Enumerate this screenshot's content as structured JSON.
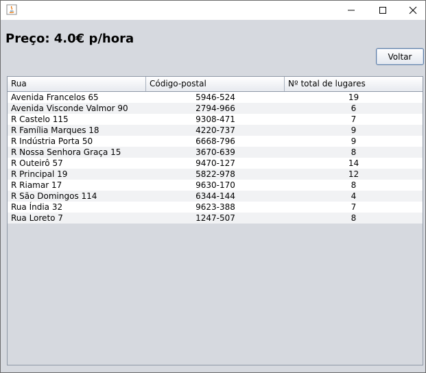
{
  "window": {
    "title": "",
    "icons": {
      "app": "java-app-icon",
      "minimize": "minimize-icon",
      "maximize": "maximize-icon",
      "close": "close-icon"
    }
  },
  "price": {
    "label": "Preço: 4.0€ p/hora"
  },
  "actions": {
    "back_label": "Voltar"
  },
  "table": {
    "columns": [
      "Rua",
      "Código-postal",
      "Nº total de lugares"
    ],
    "rows": [
      {
        "street": "Avenida Francelos 65",
        "postal_code": "5946-524",
        "total_spaces": "19"
      },
      {
        "street": "Avenida Visconde Valmor 90",
        "postal_code": "2794-966",
        "total_spaces": "6"
      },
      {
        "street": "R Castelo 115",
        "postal_code": "9308-471",
        "total_spaces": "7"
      },
      {
        "street": "R Família Marques 18",
        "postal_code": "4220-737",
        "total_spaces": "9"
      },
      {
        "street": "R Indústria Porta 50",
        "postal_code": "6668-796",
        "total_spaces": "9"
      },
      {
        "street": "R Nossa Senhora Graça 15",
        "postal_code": "3670-639",
        "total_spaces": "8"
      },
      {
        "street": "R Outeirô 57",
        "postal_code": "9470-127",
        "total_spaces": "14"
      },
      {
        "street": "R Principal 19",
        "postal_code": "5822-978",
        "total_spaces": "12"
      },
      {
        "street": "R Riamar 17",
        "postal_code": "9630-170",
        "total_spaces": "8"
      },
      {
        "street": "R São Domingos 114",
        "postal_code": "6344-144",
        "total_spaces": "4"
      },
      {
        "street": "Rua Índia 32",
        "postal_code": "9623-388",
        "total_spaces": "7"
      },
      {
        "street": "Rua Loreto 7",
        "postal_code": "1247-507",
        "total_spaces": "8"
      }
    ]
  },
  "colors": {
    "background": "#d6d9df",
    "button_border": "#5f7ea5",
    "row_alt": "#f1f2f4"
  }
}
